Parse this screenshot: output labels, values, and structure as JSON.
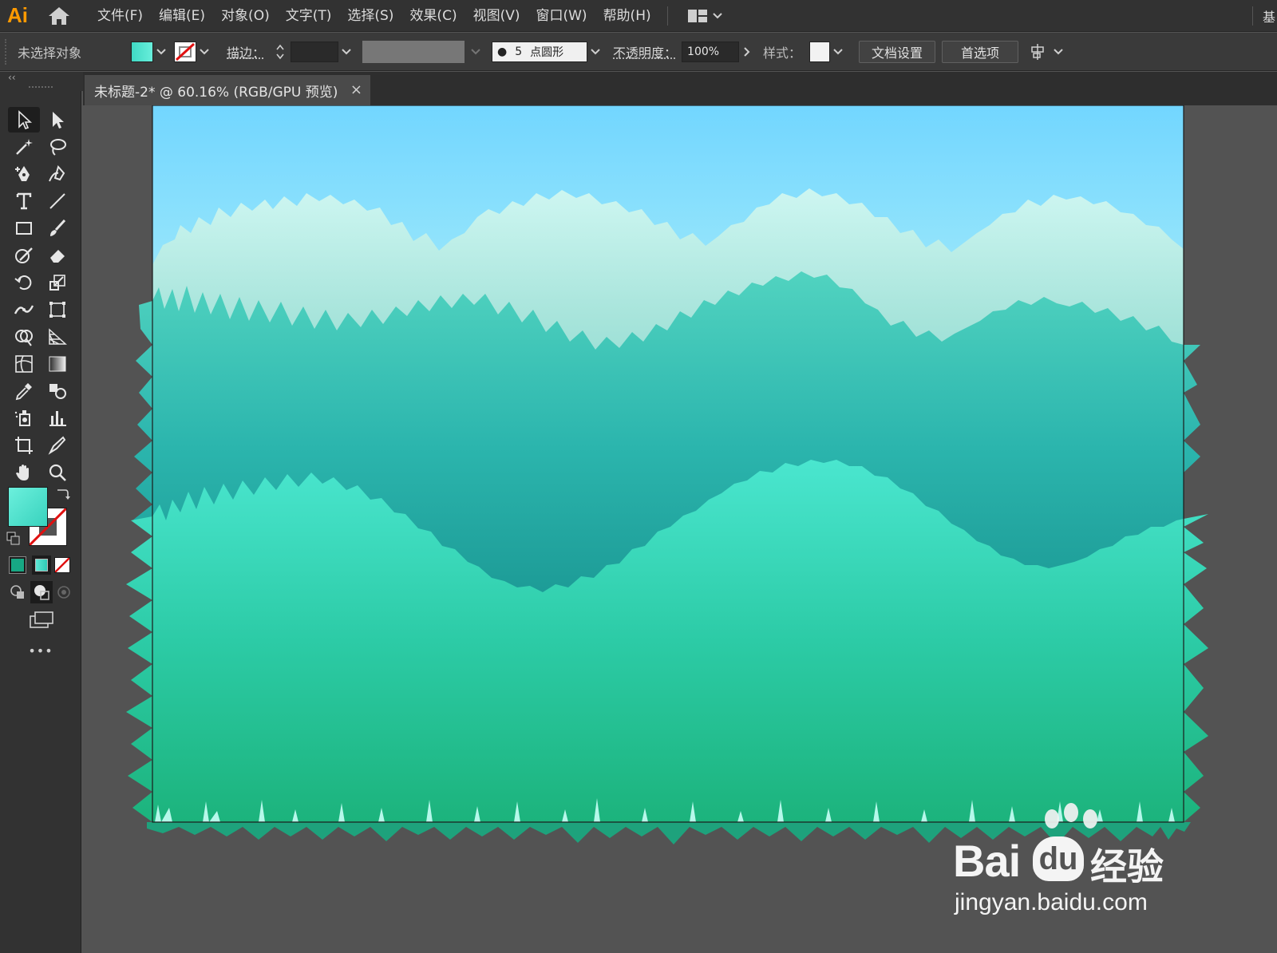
{
  "app": {
    "logo": "Ai"
  },
  "menu": [
    "文件(F)",
    "编辑(E)",
    "对象(O)",
    "文字(T)",
    "选择(S)",
    "效果(C)",
    "视图(V)",
    "窗口(W)",
    "帮助(H)"
  ],
  "menu_right_edge": "基",
  "control": {
    "selection_status": "未选择对象",
    "stroke_label": "描边：",
    "brush_dot_size": "5",
    "brush_label": "点圆形",
    "opacity_label": "不透明度：",
    "opacity_value": "100%",
    "style_label": "样式：",
    "doc_setup_button": "文档设置",
    "preferences_button": "首选项"
  },
  "document": {
    "tab_title": "未标题-2* @ 60.16% (RGB/GPU 预览)",
    "close_glyph": "×"
  },
  "toolbox": {
    "more_tools": "•••",
    "collapse_glyph": "‹‹"
  },
  "colors": {
    "fill_gradient_start": "#3fd9c4",
    "fill_gradient_end": "#68eedb",
    "sky_top": "#72d6ff",
    "sky_bottom": "#d9fff4",
    "grass_light": "#40dcc3",
    "grass_dark": "#16928f",
    "ui_dark": "#323232",
    "ui_canvas": "#535353",
    "accent_orange": "#ff9a00"
  },
  "watermark": {
    "brand_text": "Bai",
    "brand_suffix": "经验",
    "url": "jingyan.baidu.com"
  }
}
